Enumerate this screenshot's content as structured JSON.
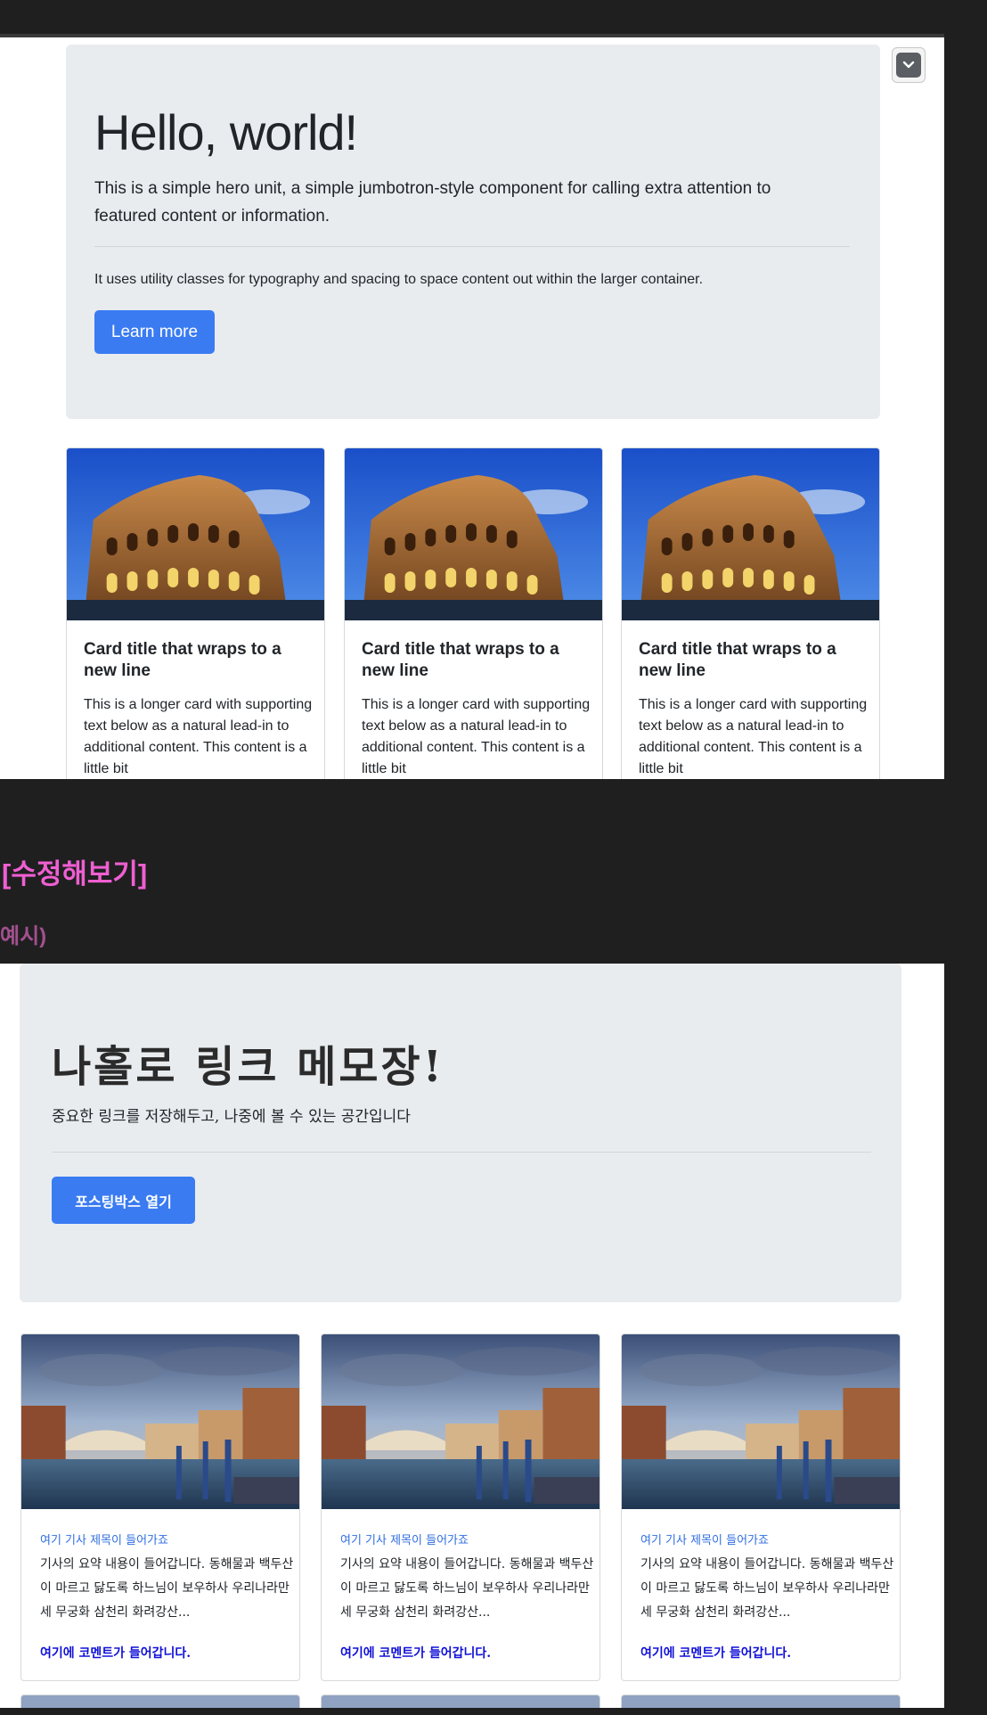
{
  "top": {
    "jumbotron": {
      "title": "Hello, world!",
      "lead": "This is a simple hero unit, a simple jumbotron-style component for calling extra attention to featured content or information.",
      "body": "It uses utility classes for typography and spacing to space content out within the larger container.",
      "button": "Learn more"
    },
    "collapse_icon": "chevron-down-icon",
    "cards": [
      {
        "title": "Card title that wraps to a new line",
        "text": "This is a longer card with supporting text below as a natural lead-in to additional content. This content is a little bit"
      },
      {
        "title": "Card title that wraps to a new line",
        "text": "This is a longer card with supporting text below as a natural lead-in to additional content. This content is a little bit"
      },
      {
        "title": "Card title that wraps to a new line",
        "text": "This is a longer card with supporting text below as a natural lead-in to additional content. This content is a little bit"
      }
    ]
  },
  "headings": {
    "edit": "[수정해보기]",
    "example": "예시)"
  },
  "bottom": {
    "jumbotron": {
      "title": "나홀로 링크 메모장!",
      "lead": "중요한 링크를 저장해두고, 나중에 볼 수 있는 공간입니다",
      "button": "포스팅박스 열기"
    },
    "cards": [
      {
        "title": "여기 기사 제목이 들어가죠",
        "text": "기사의 요약 내용이 들어갑니다. 동해물과 백두산이 마르고 닳도록 하느님이 보우하사 우리나라만세 무궁화 삼천리 화려강산...",
        "comment": "여기에 코멘트가 들어갑니다."
      },
      {
        "title": "여기 기사 제목이 들어가죠",
        "text": "기사의 요약 내용이 들어갑니다. 동해물과 백두산이 마르고 닳도록 하느님이 보우하사 우리나라만세 무궁화 삼천리 화려강산...",
        "comment": "여기에 코멘트가 들어갑니다."
      },
      {
        "title": "여기 기사 제목이 들어가죠",
        "text": "기사의 요약 내용이 들어갑니다. 동해물과 백두산이 마르고 닳도록 하느님이 보우하사 우리나라만세 무궁화 삼천리 화려강산...",
        "comment": "여기에 코멘트가 들어갑니다."
      }
    ]
  },
  "colors": {
    "primary": "#3a7bf2",
    "heading_pink": "#ef5fd2",
    "heading_purple": "#a3508f",
    "card_title_blue": "#2f6ee0",
    "comment_blue": "#1010d8"
  }
}
